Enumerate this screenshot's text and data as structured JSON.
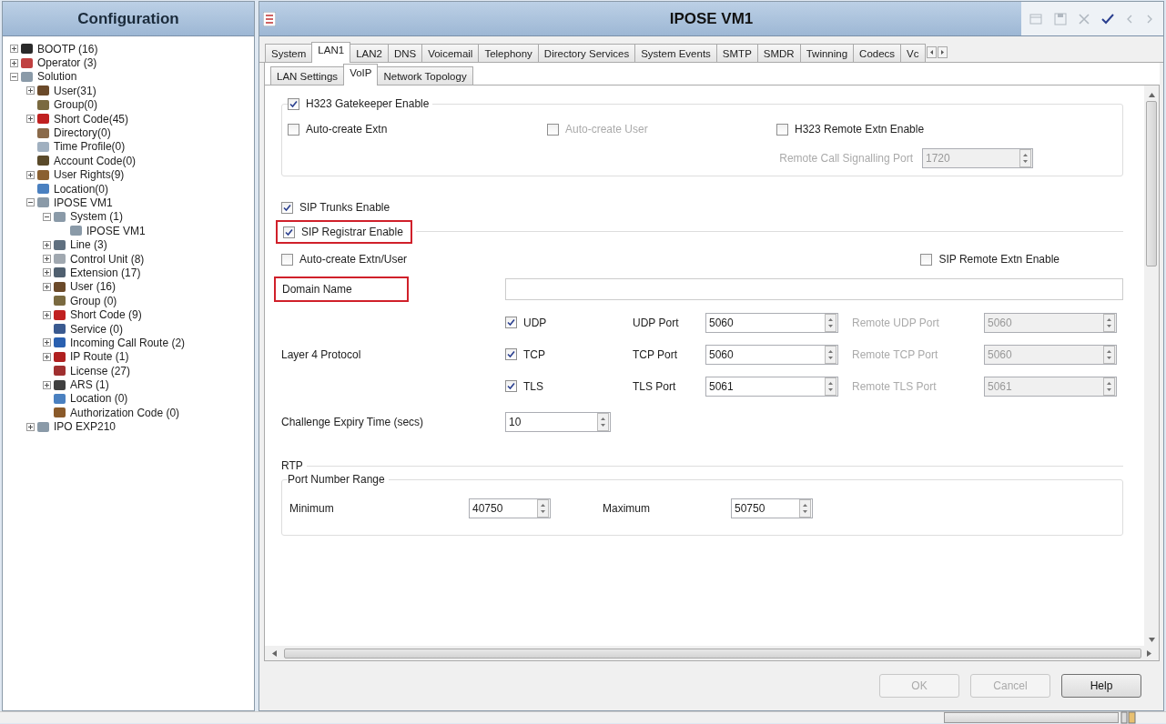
{
  "sidebar": {
    "title": "Configuration",
    "tree": [
      {
        "label": "BOOTP (16)",
        "color": "#2a2a2a",
        "expanded": false
      },
      {
        "label": "Operator (3)",
        "color": "#c04040",
        "expanded": false
      },
      {
        "label": "Solution",
        "color": "#8a9aa8",
        "expanded": true,
        "children": [
          {
            "label": "User(31)",
            "color": "#6b4a2a",
            "expanded": false
          },
          {
            "label": "Group(0)",
            "color": "#7a6a40"
          },
          {
            "label": "Short Code(45)",
            "color": "#c02020",
            "expanded": false
          },
          {
            "label": "Directory(0)",
            "color": "#8a6a4a"
          },
          {
            "label": "Time Profile(0)",
            "color": "#a0b0c0"
          },
          {
            "label": "Account Code(0)",
            "color": "#5a4a2a"
          },
          {
            "label": "User Rights(9)",
            "color": "#8a6030",
            "expanded": false
          },
          {
            "label": "Location(0)",
            "color": "#4a80c0"
          },
          {
            "label": "IPOSE VM1",
            "color": "#8a9aa8",
            "expanded": true,
            "children": [
              {
                "label": "System (1)",
                "color": "#8a9aa8",
                "expanded": true,
                "children": [
                  {
                    "label": "IPOSE VM1",
                    "color": "#8a9aa8"
                  }
                ]
              },
              {
                "label": "Line (3)",
                "color": "#607080",
                "expanded": false
              },
              {
                "label": "Control Unit (8)",
                "color": "#a0a8b0",
                "expanded": false
              },
              {
                "label": "Extension (17)",
                "color": "#506070",
                "expanded": false
              },
              {
                "label": "User (16)",
                "color": "#6b4a2a",
                "expanded": false
              },
              {
                "label": "Group (0)",
                "color": "#7a6a40"
              },
              {
                "label": "Short Code (9)",
                "color": "#c02020",
                "expanded": false
              },
              {
                "label": "Service (0)",
                "color": "#3a5a90"
              },
              {
                "label": "Incoming Call Route (2)",
                "color": "#2a60b0",
                "expanded": false
              },
              {
                "label": "IP Route (1)",
                "color": "#b02020",
                "expanded": false
              },
              {
                "label": "License (27)",
                "color": "#a03030"
              },
              {
                "label": "ARS (1)",
                "color": "#404040",
                "expanded": false
              },
              {
                "label": "Location (0)",
                "color": "#4a80c0"
              },
              {
                "label": "Authorization Code (0)",
                "color": "#8a5a2a"
              }
            ]
          },
          {
            "label": "IPO EXP210",
            "color": "#8a9aa8",
            "expanded": false
          }
        ]
      }
    ]
  },
  "editor": {
    "title": "IPOSE VM1",
    "toolbar": [
      {
        "kind": "window",
        "disabled": true
      },
      {
        "kind": "save",
        "disabled": true
      },
      {
        "kind": "delete",
        "disabled": true
      },
      {
        "kind": "validate",
        "disabled": false
      },
      {
        "kind": "back",
        "disabled": true
      },
      {
        "kind": "forward",
        "disabled": true
      }
    ],
    "tabs": [
      {
        "label": "System",
        "selected": false
      },
      {
        "label": "LAN1",
        "selected": true
      },
      {
        "label": "LAN2",
        "selected": false
      },
      {
        "label": "DNS",
        "selected": false
      },
      {
        "label": "Voicemail",
        "selected": false
      },
      {
        "label": "Telephony",
        "selected": false
      },
      {
        "label": "Directory Services",
        "selected": false
      },
      {
        "label": "System Events",
        "selected": false
      },
      {
        "label": "SMTP",
        "selected": false
      },
      {
        "label": "SMDR",
        "selected": false
      },
      {
        "label": "Twinning",
        "selected": false
      },
      {
        "label": "Codecs",
        "selected": false
      },
      {
        "label": "Vc",
        "selected": false
      }
    ],
    "subtabs": [
      {
        "label": "LAN Settings",
        "selected": false
      },
      {
        "label": "VoIP",
        "selected": true
      },
      {
        "label": "Network Topology",
        "selected": false
      }
    ],
    "h323": {
      "enable": {
        "label": "H323 Gatekeeper Enable",
        "checked": true
      },
      "options": [
        {
          "label": "Auto-create Extn",
          "checked": false,
          "disabled": false
        },
        {
          "label": "Auto-create User",
          "checked": false,
          "disabled": true
        },
        {
          "label": "H323 Remote Extn Enable",
          "checked": false,
          "disabled": false
        }
      ],
      "signalling_port": {
        "label": "Remote Call Signalling Port",
        "value": "1720",
        "disabled": true
      }
    },
    "sip_trunks": {
      "label": "SIP Trunks Enable",
      "checked": true
    },
    "sip_registrar": {
      "enable": {
        "label": "SIP Registrar Enable",
        "checked": true,
        "highlighted": true
      },
      "auto_create": {
        "label": "Auto-create Extn/User",
        "checked": false
      },
      "remote_extn": {
        "label": "SIP Remote Extn Enable",
        "checked": false
      },
      "domain": {
        "label": "Domain Name",
        "highlighted": true
      },
      "layer4": {
        "label": "Layer 4 Protocol",
        "protocols": [
          {
            "name": "UDP",
            "checked": true,
            "port_label": "UDP Port",
            "port": "5060",
            "remote_label": "Remote UDP Port",
            "remote_port": "5060",
            "remote_disabled": true
          },
          {
            "name": "TCP",
            "checked": true,
            "port_label": "TCP Port",
            "port": "5060",
            "remote_label": "Remote TCP Port",
            "remote_port": "5060",
            "remote_disabled": true
          },
          {
            "name": "TLS",
            "checked": true,
            "port_label": "TLS Port",
            "port": "5061",
            "remote_label": "Remote TLS Port",
            "remote_port": "5061",
            "remote_disabled": true
          }
        ]
      },
      "challenge": {
        "label": "Challenge Expiry Time (secs)",
        "value": "10"
      }
    },
    "rtp": {
      "title": "RTP",
      "range_title": "Port Number Range",
      "min_label": "Minimum",
      "min": "40750",
      "max_label": "Maximum",
      "max": "50750"
    },
    "buttons": [
      {
        "label": "OK",
        "disabled": true
      },
      {
        "label": "Cancel",
        "disabled": true
      },
      {
        "label": "Help",
        "disabled": false
      }
    ]
  }
}
